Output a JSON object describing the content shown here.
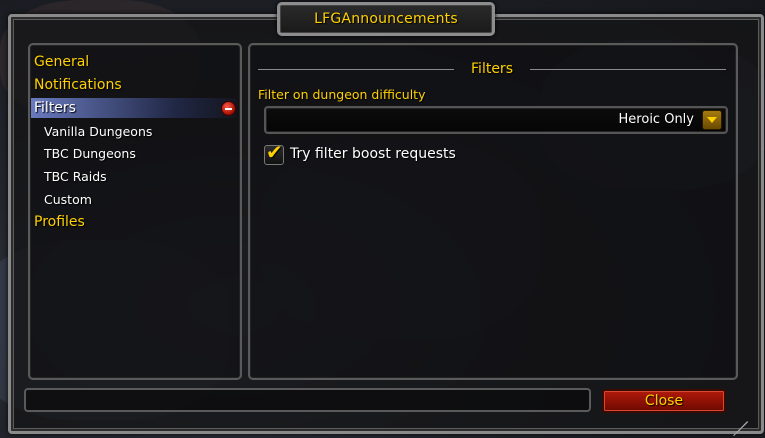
{
  "window": {
    "title": "LFGAnnouncements"
  },
  "sidebar": {
    "items": [
      {
        "label": "General",
        "type": "group"
      },
      {
        "label": "Notifications",
        "type": "group"
      },
      {
        "label": "Filters",
        "type": "group",
        "selected": true,
        "expanded": true
      },
      {
        "label": "Vanilla Dungeons",
        "type": "child"
      },
      {
        "label": "TBC Dungeons",
        "type": "child"
      },
      {
        "label": "TBC Raids",
        "type": "child"
      },
      {
        "label": "Custom",
        "type": "child"
      },
      {
        "label": "Profiles",
        "type": "group"
      }
    ]
  },
  "content": {
    "section_title": "Filters",
    "difficulty_label": "Filter on dungeon difficulty",
    "difficulty_value": "Heroic Only",
    "boost_label": "Try filter boost requests",
    "boost_checked": true
  },
  "footer": {
    "status_text": "",
    "close_label": "Close"
  },
  "colors": {
    "accent_gold": "#ffd100",
    "close_red": "#b01a0a",
    "selected_blue": "#788cdc"
  }
}
